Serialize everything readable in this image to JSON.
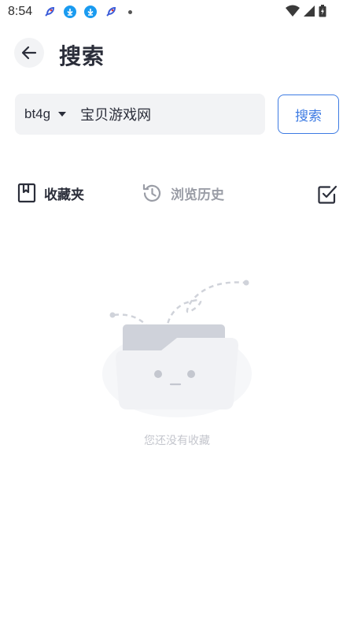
{
  "status_bar": {
    "time": "8:54",
    "left_icons": [
      "rocket-icon",
      "download-icon",
      "download-icon",
      "rocket-icon",
      "dot-icon"
    ],
    "right_icons": [
      "wifi-icon",
      "signal-icon",
      "battery-icon"
    ]
  },
  "header": {
    "title": "搜索"
  },
  "search": {
    "engine": "bt4g",
    "query": "宝贝游戏网",
    "button_label": "搜索"
  },
  "tabs": {
    "favorites_label": "收藏夹",
    "history_label": "浏览历史",
    "active": "favorites"
  },
  "empty_state": {
    "message": "您还没有收藏"
  },
  "colors": {
    "accent": "#3d7be3",
    "text": "#2b2e3a",
    "muted": "#9a9da6",
    "input_bg": "#f2f3f5"
  }
}
